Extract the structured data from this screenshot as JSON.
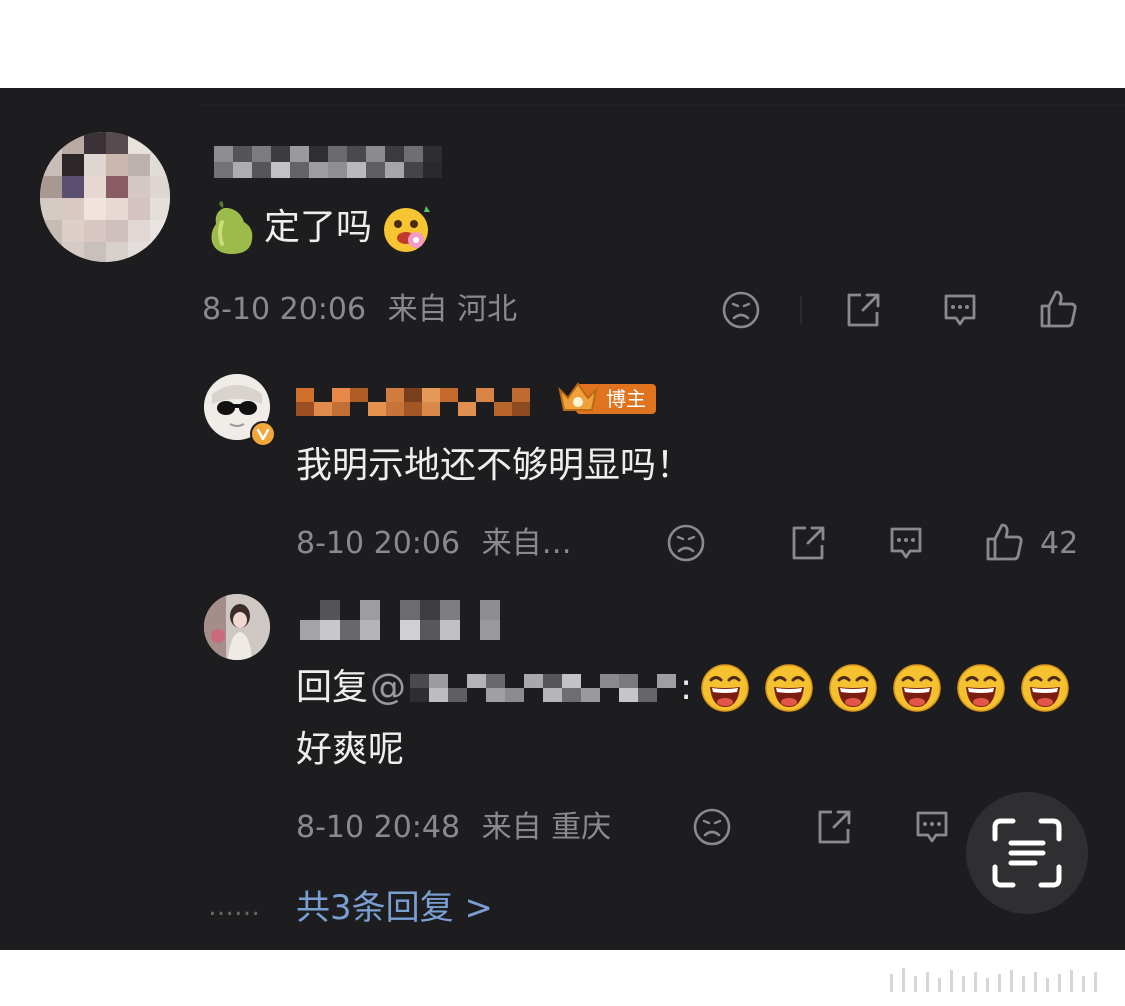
{
  "comment": {
    "text": "定了吗",
    "timestamp": "8-10 20:06",
    "location": "来自 河北"
  },
  "reply1": {
    "badge": "博主",
    "text": "我明示地还不够明显吗！",
    "timestamp": "8-10 20:06",
    "location": "来自…",
    "likes": "42"
  },
  "reply2": {
    "prefix": "回复",
    "colon": ":",
    "text": "好爽呢",
    "timestamp": "8-10 20:48",
    "location": "来自 重庆"
  },
  "footer": {
    "dots": "……",
    "more_replies": "共3条回复 >"
  },
  "icons": [
    "dislike-icon",
    "share-icon",
    "comment-icon",
    "like-icon",
    "scan-text-icon",
    "pear-emoji-icon",
    "drooling-emoji-icon",
    "laugh-emoji-icon",
    "crown-icon",
    "verified-icon"
  ],
  "colors": {
    "background": "#1d1d1f",
    "text": "#eeeeee",
    "meta": "#8a8a8e",
    "badge": "#e0731e",
    "link": "#7a9fd3"
  }
}
